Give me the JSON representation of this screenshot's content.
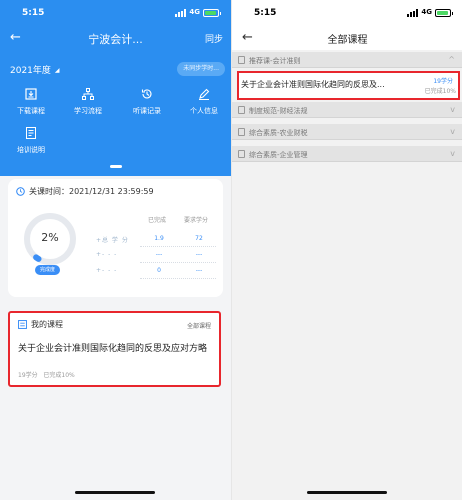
{
  "left": {
    "status": {
      "time": "5:15",
      "network": "4G"
    },
    "nav": {
      "title": "宁波会计...",
      "sync": "同步"
    },
    "year": "2021年度",
    "unsync_badge": "未同步学时...",
    "menu": [
      {
        "label": "下载课程",
        "icon": "download-icon"
      },
      {
        "label": "学习流程",
        "icon": "flow-icon"
      },
      {
        "label": "听课记录",
        "icon": "history-icon"
      },
      {
        "label": "个人信息",
        "icon": "edit-icon"
      },
      {
        "label": "培训说明",
        "icon": "document-icon"
      }
    ],
    "deadline": "关课时间：2021/12/31 23:59:59",
    "progress": {
      "value_text": "2%",
      "value": 0.02,
      "label": "完成度"
    },
    "stats": {
      "col_done": "已完成",
      "col_required": "要求学分",
      "rows": [
        {
          "label": "+总 学 分",
          "done": "1.9",
          "required": "72"
        },
        {
          "label": "+- - -",
          "done": "---",
          "required": "---"
        },
        {
          "label": "+- - -",
          "done": "0",
          "required": "---"
        }
      ]
    },
    "my_courses": {
      "title": "我的课程",
      "all": "全部课程",
      "course_name": "关于企业会计准则国际化趋同的反思及应对方略",
      "credits": "19学分",
      "progress": "已完成10%"
    }
  },
  "right": {
    "status": {
      "time": "5:15",
      "network": "4G"
    },
    "title": "全部课程",
    "sections": [
      {
        "label": "推荐课-会计准则",
        "chevron": "^"
      },
      {
        "label": "制度规范-财经法规",
        "chevron": "v"
      },
      {
        "label": "综合素质-农业财税",
        "chevron": "v"
      },
      {
        "label": "综合素质-企业管理",
        "chevron": "v"
      }
    ],
    "course": {
      "name": "关于企业会计准则国际化趋同的反思及...",
      "credits": "19学分",
      "progress": "已完成10%"
    }
  },
  "colors": {
    "primary": "#2b8ef0",
    "highlight": "#e8262d"
  }
}
